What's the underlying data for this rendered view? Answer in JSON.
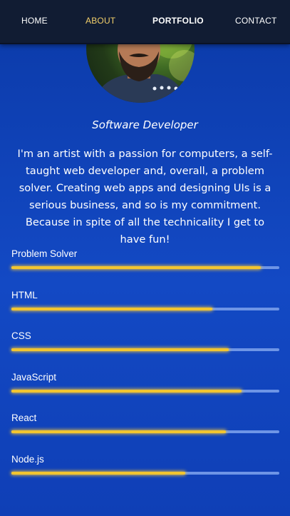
{
  "nav": {
    "items": [
      {
        "label": "HOME"
      },
      {
        "label": "ABOUT",
        "active": true
      },
      {
        "label": "PORTFOLIO"
      },
      {
        "label": "CONTACT"
      }
    ],
    "active_color": "#f3cf6a"
  },
  "profile": {
    "role": "Software Developer",
    "bio": "I'm an artist with a passion for computers, a self-taught web developer and, overall, a problem solver. Creating web apps and designing UIs is a serious business, and so is my commitment. Because in spite of all the technicality I get to have fun!"
  },
  "skills": [
    {
      "name": "Problem Solver",
      "level": 0.93
    },
    {
      "name": "HTML",
      "level": 0.75
    },
    {
      "name": "CSS",
      "level": 0.81
    },
    {
      "name": "JavaScript",
      "level": 0.86
    },
    {
      "name": "React",
      "level": 0.8
    },
    {
      "name": "Node.js",
      "level": 0.65
    }
  ],
  "colors": {
    "background": "#1349c4",
    "navbar": "#111c33",
    "bar_fill": "#f2c530",
    "bar_track": "#6e95e6"
  }
}
